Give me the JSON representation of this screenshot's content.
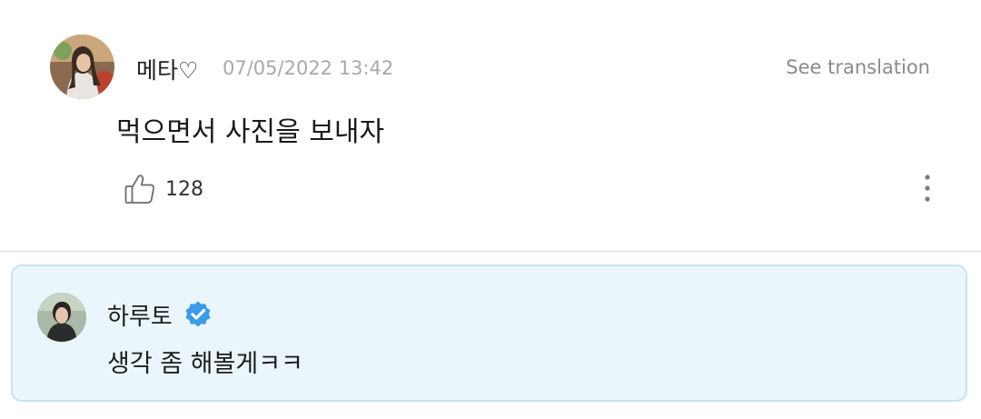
{
  "comment": {
    "author": "메타♡",
    "timestamp": "07/05/2022 13:42",
    "translate_label": "See translation",
    "text": "먹으면서 사진을 보내자",
    "like_count": "128",
    "like_icon": "thumbs-up-outline-icon",
    "more_icon": "vertical-ellipsis-icon"
  },
  "reply": {
    "author": "하루토",
    "verified_icon": "verified-badge-icon",
    "text": "생각 좀 해볼게ㅋㅋ"
  },
  "colors": {
    "reply_background": "#eaf6fc",
    "reply_border": "#c8e3ee",
    "verified_badge": "#3b9ce8",
    "timestamp": "#a9a9a9"
  }
}
